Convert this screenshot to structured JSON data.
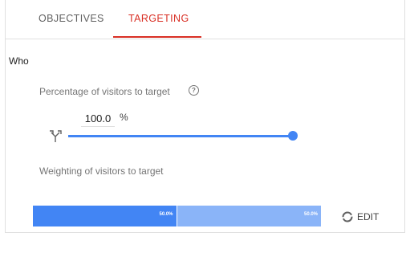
{
  "tabs": [
    {
      "label": "OBJECTIVES",
      "active": false
    },
    {
      "label": "TARGETING",
      "active": true
    }
  ],
  "section": {
    "title": "Who"
  },
  "percentage": {
    "label": "Percentage of visitors to target",
    "value": "100.0",
    "unit": "%",
    "slider_fraction": 1.0
  },
  "weighting": {
    "label": "Weighting of visitors to target",
    "variants": [
      {
        "label": "50.0%",
        "fraction": 0.5
      },
      {
        "label": "50.0%",
        "fraction": 0.5
      }
    ],
    "edit_label": "EDIT"
  },
  "icons": {
    "help": "help-circle-icon",
    "split": "call-split-icon",
    "edit": "pie-chart-icon"
  },
  "colors": {
    "active_tab": "#d93025",
    "primary_blue": "#4285f4",
    "light_blue": "#8ab4f8"
  }
}
